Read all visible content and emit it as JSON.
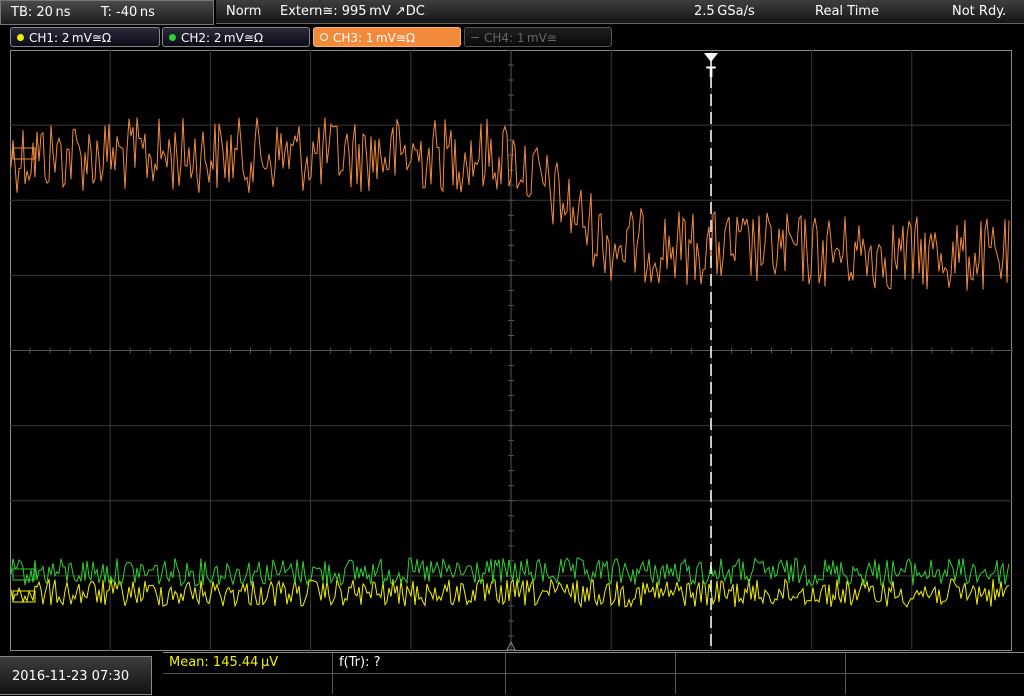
{
  "topbar": {
    "timebase": "TB: 20 ns",
    "trigger_time": "T: -40 ns",
    "mode": "Norm",
    "trigger": "Extern≅: 995 mV ↗DC",
    "sample_rate": "2.5 GSa/s",
    "acq_mode": "Real Time",
    "status": "Not Rdy."
  },
  "channels": [
    {
      "label": "CH1: 2 mV≅Ω",
      "color": "#f0f000",
      "state": "on"
    },
    {
      "label": "CH2: 2 mV≅Ω",
      "color": "#30d030",
      "state": "on"
    },
    {
      "label": "CH3: 1 mV≅Ω",
      "color": "#f28a3c",
      "state": "active"
    },
    {
      "label": "CH4: 1 mV≅",
      "color": "#666666",
      "state": "off"
    }
  ],
  "display": {
    "trigger_marker": "T",
    "grid_color": "#3a3a3a"
  },
  "bottombar": {
    "datetime": "2016-11-23 07:30",
    "measurement_1": "Mean: 145.44 µV",
    "measurement_2": "f(Tr): ?"
  },
  "colors": {
    "ch1": "#f0f000",
    "ch2": "#30d030",
    "ch3": "#f28a3c",
    "ch3_active_bg": "#f28a3c"
  }
}
